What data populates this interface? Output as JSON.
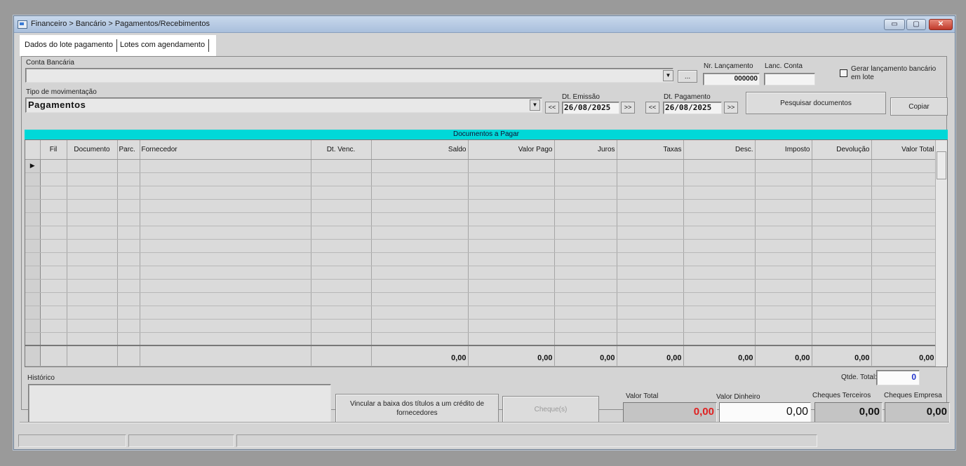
{
  "window": {
    "title": "Financeiro > Bancário > Pagamentos/Recebimentos",
    "min_label": "▭",
    "max_label": "▢",
    "close_label": "✕"
  },
  "tabs": [
    {
      "label": "Dados do lote pagamento",
      "active": true
    },
    {
      "label": "Lotes com agendamento",
      "active": false
    }
  ],
  "form": {
    "conta_bancaria_label": "Conta Bancária",
    "conta_bancaria_value": "",
    "ellipsis_label": "...",
    "nr_lancamento_label": "Nr. Lançamento",
    "nr_lancamento_value": "000000",
    "lanc_conta_label": "Lanc. Conta",
    "lanc_conta_value": "",
    "gerar_label_line1": "Gerar lançamento bancário",
    "gerar_label_line2": "em lote",
    "tipo_label": "Tipo de movimentação",
    "tipo_value": "Pagamentos",
    "dt_emissao_label": "Dt. Emissão",
    "dt_emissao_value": "26/08/2025",
    "dt_pagamento_label": "Dt. Pagamento",
    "dt_pagamento_value": "26/08/2025",
    "prev_label": "<<",
    "next_label": ">>",
    "pesquisar_label": "Pesquisar documentos",
    "copiar_label": "Copiar"
  },
  "grid": {
    "band_title": "Documentos a Pagar",
    "columns": [
      "Fil",
      "Documento",
      "Parc.",
      "Fornecedor",
      "Dt. Venc.",
      "Saldo",
      "Valor Pago",
      "Juros",
      "Taxas",
      "Desc.",
      "Imposto",
      "Devolução",
      "Valor Total"
    ],
    "row_count": 14,
    "row_indicator": "▶",
    "totals": [
      "",
      "",
      "",
      "",
      "",
      "0,00",
      "0,00",
      "0,00",
      "0,00",
      "0,00",
      "0,00",
      "0,00",
      "0,00"
    ]
  },
  "footer": {
    "historico_label": "Histórico",
    "historico_value": "",
    "qtde_total_label": "Qtde. Total:",
    "qtde_total_value": "0",
    "vincular_label": "Vincular a baixa dos títulos a um crédito de fornecedores",
    "cheques_label": "Cheque(s)",
    "valor_total_label": "Valor Total",
    "valor_total_value": "0,00",
    "valor_dinheiro_label": "Valor Dinheiro",
    "valor_dinheiro_value": "0,00",
    "cheques_terceiros_label": "Cheques Terceiros",
    "cheques_terceiros_value": "0,00",
    "cheques_empresa_label": "Cheques Empresa",
    "cheques_empresa_value": "0,00"
  },
  "colors": {
    "band": "#00d8d8",
    "valor_total_text": "#e02020",
    "qtde_text": "#2233cc"
  }
}
